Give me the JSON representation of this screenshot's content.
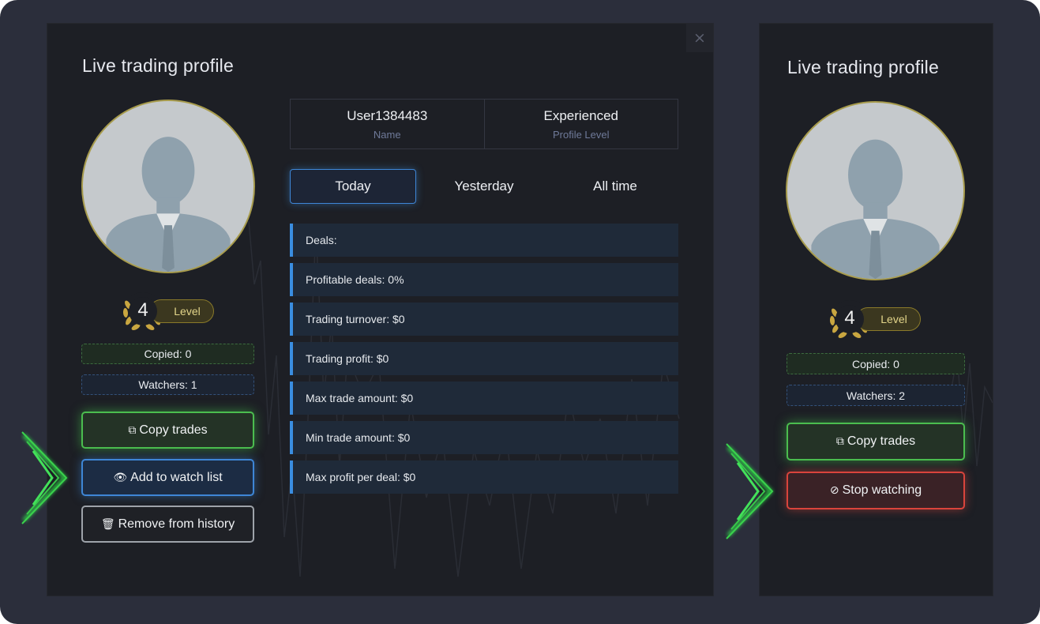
{
  "main_profile": {
    "title": "Live trading profile",
    "close_glyph": "×",
    "level": {
      "number": "4",
      "label": "Level"
    },
    "copied": "Copied: 0",
    "watchers": "Watchers: 1",
    "buttons": {
      "copy": {
        "icon": "copy-icon",
        "label": "Copy trades"
      },
      "watch": {
        "icon": "eye-icon",
        "label": "Add to watch list"
      },
      "remove": {
        "icon": "trash-icon",
        "label": "Remove from history"
      }
    },
    "info": {
      "name_value": "User1384483",
      "name_label": "Name",
      "level_value": "Experienced",
      "level_label": "Profile Level"
    },
    "tabs": [
      {
        "label": "Today",
        "active": true
      },
      {
        "label": "Yesterday",
        "active": false
      },
      {
        "label": "All time",
        "active": false
      }
    ],
    "stats": [
      "Deals:",
      "Profitable deals: 0%",
      "Trading turnover: $0",
      "Trading profit: $0",
      "Max trade amount: $0",
      "Min trade amount: $0",
      "Max profit per deal: $0"
    ]
  },
  "side_profile": {
    "title": "Live trading profile",
    "level": {
      "number": "4",
      "label": "Level"
    },
    "copied": "Copied: 0",
    "watchers": "Watchers: 2",
    "buttons": {
      "copy": {
        "icon": "copy-icon",
        "label": "Copy trades"
      },
      "stop": {
        "icon": "eye-slash-icon",
        "label": "Stop watching"
      }
    }
  },
  "colors": {
    "accent_green": "#4bbd4f",
    "accent_blue": "#3e86d6",
    "accent_red": "#d9443c",
    "gold": "#a79b4c"
  }
}
